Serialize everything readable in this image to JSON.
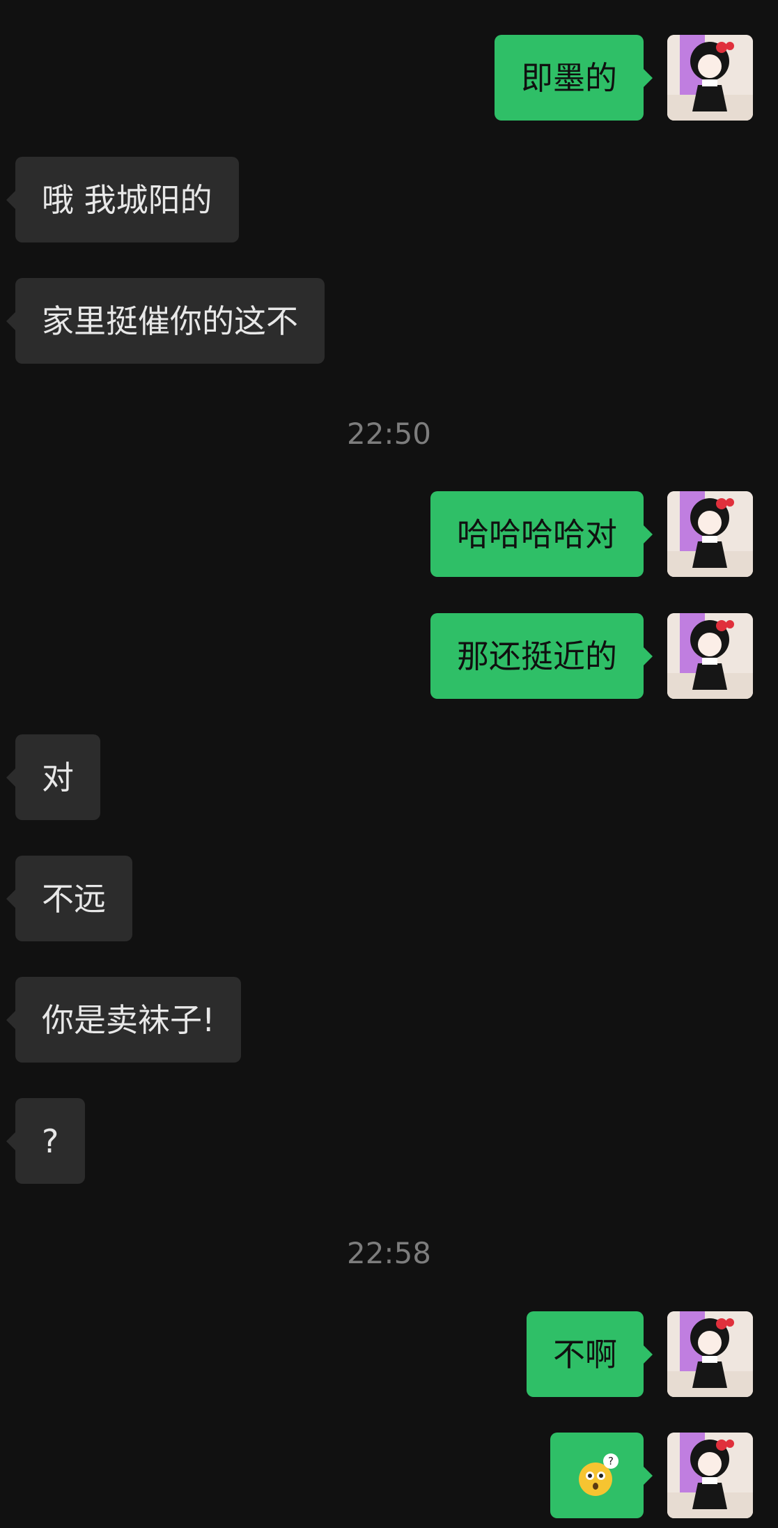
{
  "messages": [
    {
      "side": "me",
      "text": "即墨的"
    },
    {
      "side": "them",
      "text": "哦 我城阳的"
    },
    {
      "side": "them",
      "text": "家里挺催你的这不"
    },
    {
      "side": "me",
      "text": "哈哈哈哈对"
    },
    {
      "side": "me",
      "text": "那还挺近的"
    },
    {
      "side": "them",
      "text": "对"
    },
    {
      "side": "them",
      "text": "不远"
    },
    {
      "side": "them",
      "text": "你是卖袜子!"
    },
    {
      "side": "them",
      "text": "?"
    },
    {
      "side": "me",
      "text": "不啊"
    },
    {
      "side": "me",
      "type": "emoji",
      "icon": "confused-face-icon"
    }
  ],
  "timestamps": [
    "22:50",
    "22:58"
  ],
  "colors": {
    "background": "#111111",
    "outgoing_bubble": "#2fbf67",
    "incoming_bubble": "#2c2c2c",
    "timestamp": "#7d7d7d"
  }
}
